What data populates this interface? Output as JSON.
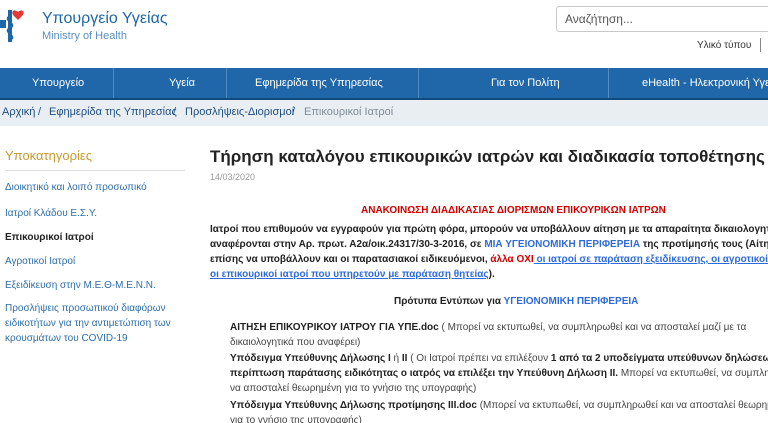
{
  "header": {
    "logo_title": "Υπουργείο Υγείας",
    "logo_subtitle": "Ministry of Health",
    "search_placeholder": "Αναζήτηση...",
    "util_link": "Υλικό τύπου"
  },
  "nav": {
    "items": [
      {
        "label": "Υπουργείο"
      },
      {
        "label": "Υγεία"
      },
      {
        "label": "Εφημερίδα της Υπηρεσίας"
      },
      {
        "label": "Για τον Πολίτη"
      },
      {
        "label": "eHealth - Ηλεκτρονική Υγεί"
      }
    ]
  },
  "breadcrumb": {
    "items": [
      "Αρχική",
      "Εφημερίδα της Υπηρεσίας",
      "Προσλήψεις-Διορισμοί",
      "Επικουρικοί Ιατροί"
    ],
    "separator": "/"
  },
  "sidebar": {
    "title": "Υποκατηγορίες",
    "items": [
      "Διοικητικό και λοιπό προσωπικό",
      "Ιατροί Κλάδου Ε.Σ.Υ.",
      "Επικουρικοί Ιατροί",
      "Αγροτικοί Ιατροί",
      "Εξειδίκευση στην Μ.Ε.Θ-Μ.Ε.Ν.Ν."
    ],
    "multiline_item": [
      "Προσλήψεις προσωπικού διαφόρων",
      "ειδικοτήτων για την αντιμετώπιση των",
      "κρουσμάτων του COVID-19"
    ]
  },
  "article": {
    "title": "Τήρηση καταλόγου επικουρικών ιατρών και διαδικασία τοποθέτησης",
    "date": "14/03/2020",
    "announcement": "ΑΝΑΚΟΙΝΩΣΗ ΔΙΑΔΙΚΑΣΙΑΣ ΔΙΟΡΙΣΜΩΝ ΕΠΙΚΟΥΡΙΚΩΝ ΙΑΤΡΩΝ",
    "para_line1": "Ιατροί που επιθυμούν να εγγραφούν για πρώτη φόρα, μπορούν να υποβάλλουν αίτηση με τα απαραίτητα δικαιολογητι",
    "para_line2_a": "αναφέρονται στην Αρ. πρωτ. Α2α/οικ.24317/30-3-2016, σε ",
    "para_line2_b": "ΜΙΑ ΥΓΕΙΟΝΟΜΙΚΗ ΠΕΡΙΦΕΡΕΙΑ",
    "para_line2_c": " της προτίμησής τους (Αίτηση μ",
    "para_line3_a": "επίσης να υποβάλλουν και οι παρατασιακοί ειδικευόμενοι, ",
    "para_line3_b": "άλλα ΟΧΙ",
    "para_line3_c": " οι ιατροί σε παράταση εξειδίκευσης, οι αγροτικοί ιατ",
    "para_line4_a": "οι επικουρικοί ιατροί που υπηρετούν με παράταση θητείας",
    "para_line4_b": ").",
    "forms_title_a": "Πρότυπα Εντύπων για ",
    "forms_title_b": "ΥΓΕΙΟΝΟΜΙΚΗ ΠΕΡΙΦΕΡΕΙΑ",
    "item1_bold": "ΑΙΤΗΣΗ ΕΠΙΚΟΥΡΙΚΟΥ ΙΑΤΡΟΥ ΓΙΑ ΥΠΕ.doc",
    "item1_rest": " ( Μπορεί να εκτυπωθεί, να συμπληρωθεί και να αποσταλεί μαζί με τα",
    "item1_line2": "δικαιολογητικά που αναφέρει)",
    "item2_bold_a": "Υπόδειγμα Υπεύθυνης Δήλωσης I",
    "item2_mid": " ή ",
    "item2_bold_b": "II",
    "item2_rest_a": " ( Οι Ιατροί πρέπει να επιλέξουν ",
    "item2_bold_c": "1 από τα 2 υποδείγματα υπεύθυνων δηλώσεων, σ",
    "item2_line2_a": "περίπτωση παράτασης ειδικότητας ο ιατρός να επιλέξει την Υπεύθυνη Δήλωση ΙΙ.",
    "item2_line2_b": " Μπορεί να εκτυπωθεί, να συμπληρ",
    "item2_line3": "να αποσταλεί θεωρημένη για το γνήσιο της υπογραφής)",
    "item3_bold": "Υπόδειγμα Υπεύθυνης Δήλωσης προτίμησης ΙΙΙ.doc",
    "item3_rest": " (Μπορεί να εκτυπωθεί, να συμπληρωθεί και να αποσταλεί θεωρημ",
    "item3_line2": "για το γνήσιο της υπογραφής)"
  },
  "colors": {
    "nav_bg": "#1f67a8",
    "link_blue": "#2e6bd9",
    "alert_red": "#d30000",
    "sidebar_title": "#c79a2f"
  }
}
